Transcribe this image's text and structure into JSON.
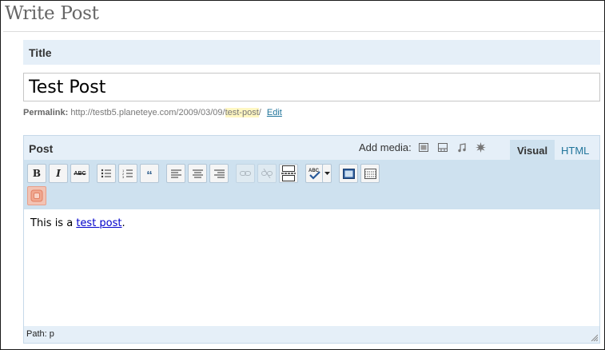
{
  "page": {
    "title": "Write Post"
  },
  "title_section": {
    "label": "Title",
    "value": "Test Post"
  },
  "permalink": {
    "label": "Permalink:",
    "base_url": "http://testb5.planeteye.com/2009/03/09/",
    "slug": "test-post",
    "trailing": "/",
    "edit_label": "Edit"
  },
  "post_section": {
    "label": "Post",
    "add_media_label": "Add media:",
    "media_icons": [
      "image-icon",
      "video-icon",
      "audio-icon",
      "media-icon"
    ],
    "tabs": {
      "visual": "Visual",
      "html": "HTML"
    }
  },
  "toolbar": {
    "row1": [
      "bold-icon",
      "italic-icon",
      "strikethrough-icon",
      "bullet-list-icon",
      "numbered-list-icon",
      "blockquote-icon",
      "align-left-icon",
      "align-center-icon",
      "align-right-icon",
      "link-icon",
      "unlink-icon",
      "more-tag-icon",
      "spellcheck-icon",
      "fullscreen-icon",
      "kitchen-sink-icon"
    ],
    "row2": [
      "special-plugin-icon"
    ],
    "disabled": [
      "link-icon",
      "unlink-icon"
    ]
  },
  "editor": {
    "text_before": "This is a ",
    "link_text": "test post",
    "text_after": "."
  },
  "path_bar": {
    "text": "Path: p"
  },
  "colors": {
    "panel_bg": "#e5eff8",
    "toolbar_bg": "#cee1ef",
    "link": "#21759b",
    "slug_highlight": "#fff7c2"
  }
}
